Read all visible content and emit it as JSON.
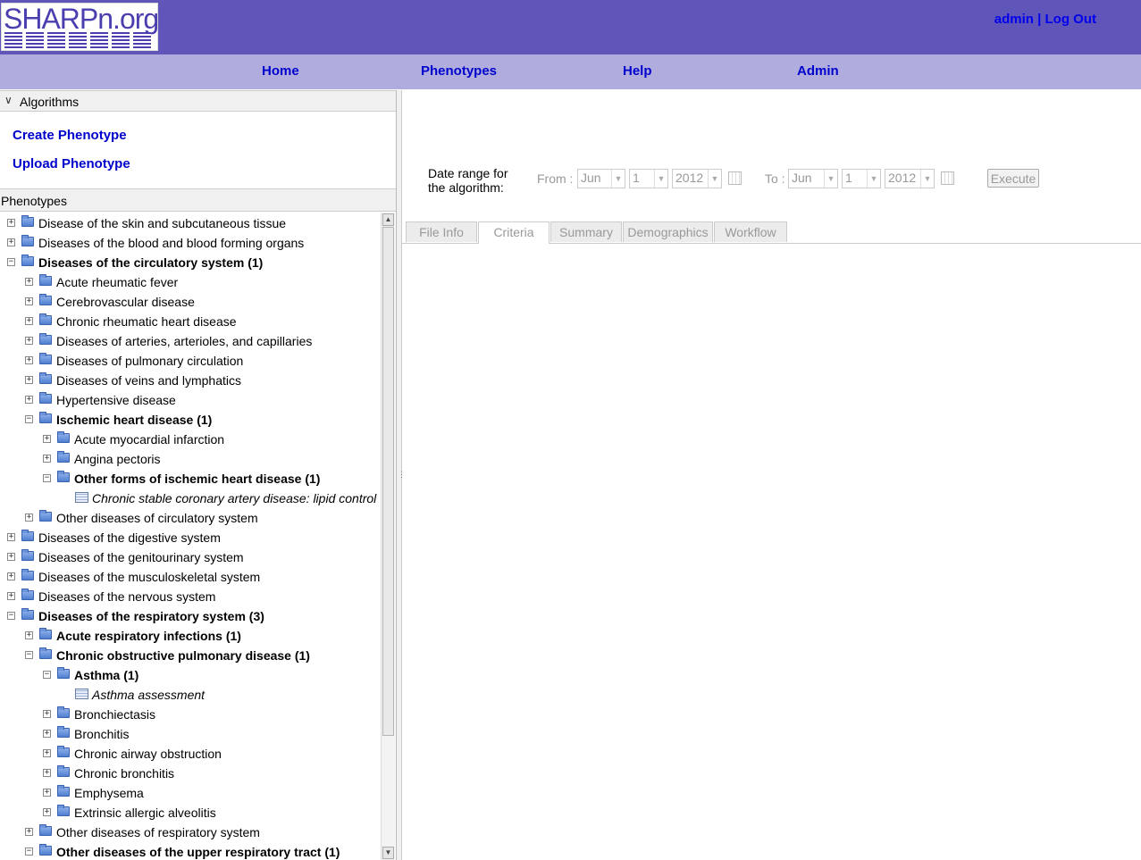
{
  "header": {
    "logo_text": "SHARPn.org",
    "user": "admin",
    "separator": "|",
    "logout": "Log Out"
  },
  "nav": [
    "Home",
    "Phenotypes",
    "Help",
    "Admin"
  ],
  "algorithms": {
    "title": "Algorithms",
    "links": [
      "Create Phenotype",
      "Upload Phenotype"
    ]
  },
  "phenotypes": {
    "title": "Phenotypes",
    "tree": [
      {
        "label": "Disease of the skin and subcutaneous tissue",
        "level": 0,
        "type": "folder",
        "expanded": false,
        "bold": false
      },
      {
        "label": "Diseases of the blood and blood forming organs",
        "level": 0,
        "type": "folder",
        "expanded": false,
        "bold": false
      },
      {
        "label": "Diseases of the circulatory system (1)",
        "level": 0,
        "type": "folder",
        "expanded": true,
        "bold": true
      },
      {
        "label": "Acute rheumatic fever",
        "level": 1,
        "type": "folder",
        "expanded": false,
        "bold": false
      },
      {
        "label": "Cerebrovascular disease",
        "level": 1,
        "type": "folder",
        "expanded": false,
        "bold": false
      },
      {
        "label": "Chronic rheumatic heart disease",
        "level": 1,
        "type": "folder",
        "expanded": false,
        "bold": false
      },
      {
        "label": "Diseases of arteries, arterioles, and capillaries",
        "level": 1,
        "type": "folder",
        "expanded": false,
        "bold": false
      },
      {
        "label": "Diseases of pulmonary circulation",
        "level": 1,
        "type": "folder",
        "expanded": false,
        "bold": false
      },
      {
        "label": "Diseases of veins and lymphatics",
        "level": 1,
        "type": "folder",
        "expanded": false,
        "bold": false
      },
      {
        "label": "Hypertensive disease",
        "level": 1,
        "type": "folder",
        "expanded": false,
        "bold": false
      },
      {
        "label": "Ischemic heart disease (1)",
        "level": 1,
        "type": "folder",
        "expanded": true,
        "bold": true
      },
      {
        "label": "Acute myocardial infarction",
        "level": 2,
        "type": "folder",
        "expanded": false,
        "bold": false
      },
      {
        "label": "Angina pectoris",
        "level": 2,
        "type": "folder",
        "expanded": false,
        "bold": false
      },
      {
        "label": "Other forms of ischemic heart disease (1)",
        "level": 2,
        "type": "folder",
        "expanded": true,
        "bold": true
      },
      {
        "label": "Chronic stable coronary artery disease: lipid control",
        "level": 3,
        "type": "doc",
        "bold": false
      },
      {
        "label": "Other diseases of circulatory system",
        "level": 1,
        "type": "folder",
        "expanded": false,
        "bold": false
      },
      {
        "label": "Diseases of the digestive system",
        "level": 0,
        "type": "folder",
        "expanded": false,
        "bold": false
      },
      {
        "label": "Diseases of the genitourinary system",
        "level": 0,
        "type": "folder",
        "expanded": false,
        "bold": false
      },
      {
        "label": "Diseases of the musculoskeletal system",
        "level": 0,
        "type": "folder",
        "expanded": false,
        "bold": false
      },
      {
        "label": "Diseases of the nervous system",
        "level": 0,
        "type": "folder",
        "expanded": false,
        "bold": false
      },
      {
        "label": "Diseases of the respiratory system (3)",
        "level": 0,
        "type": "folder",
        "expanded": true,
        "bold": true
      },
      {
        "label": "Acute respiratory infections (1)",
        "level": 1,
        "type": "folder",
        "expanded": false,
        "bold": true
      },
      {
        "label": "Chronic obstructive pulmonary disease (1)",
        "level": 1,
        "type": "folder",
        "expanded": true,
        "bold": true
      },
      {
        "label": "Asthma (1)",
        "level": 2,
        "type": "folder",
        "expanded": true,
        "bold": true
      },
      {
        "label": "Asthma assessment",
        "level": 3,
        "type": "doc",
        "bold": false
      },
      {
        "label": "Bronchiectasis",
        "level": 2,
        "type": "folder",
        "expanded": false,
        "bold": false
      },
      {
        "label": "Bronchitis",
        "level": 2,
        "type": "folder",
        "expanded": false,
        "bold": false
      },
      {
        "label": "Chronic airway obstruction",
        "level": 2,
        "type": "folder",
        "expanded": false,
        "bold": false
      },
      {
        "label": "Chronic bronchitis",
        "level": 2,
        "type": "folder",
        "expanded": false,
        "bold": false
      },
      {
        "label": "Emphysema",
        "level": 2,
        "type": "folder",
        "expanded": false,
        "bold": false
      },
      {
        "label": "Extrinsic allergic alveolitis",
        "level": 2,
        "type": "folder",
        "expanded": false,
        "bold": false
      },
      {
        "label": "Other diseases of respiratory system",
        "level": 1,
        "type": "folder",
        "expanded": false,
        "bold": false
      },
      {
        "label": "Other diseases of the upper respiratory tract (1)",
        "level": 1,
        "type": "folder",
        "expanded": true,
        "bold": true
      }
    ]
  },
  "date_range": {
    "label": "Date range for the algorithm:",
    "from_label": "From :",
    "from": {
      "month": "Jun",
      "day": "1",
      "year": "2012"
    },
    "to_label": "To :",
    "to": {
      "month": "Jun",
      "day": "1",
      "year": "2012"
    },
    "execute": "Execute"
  },
  "tabs": [
    {
      "label": "File Info",
      "active": false
    },
    {
      "label": "Criteria",
      "active": true
    },
    {
      "label": "Summary",
      "active": false
    },
    {
      "label": "Demographics",
      "active": false
    },
    {
      "label": "Workflow",
      "active": false
    }
  ],
  "colors": {
    "header": "#6055b8",
    "nav": "#b0acde",
    "link": "#0000cc"
  }
}
